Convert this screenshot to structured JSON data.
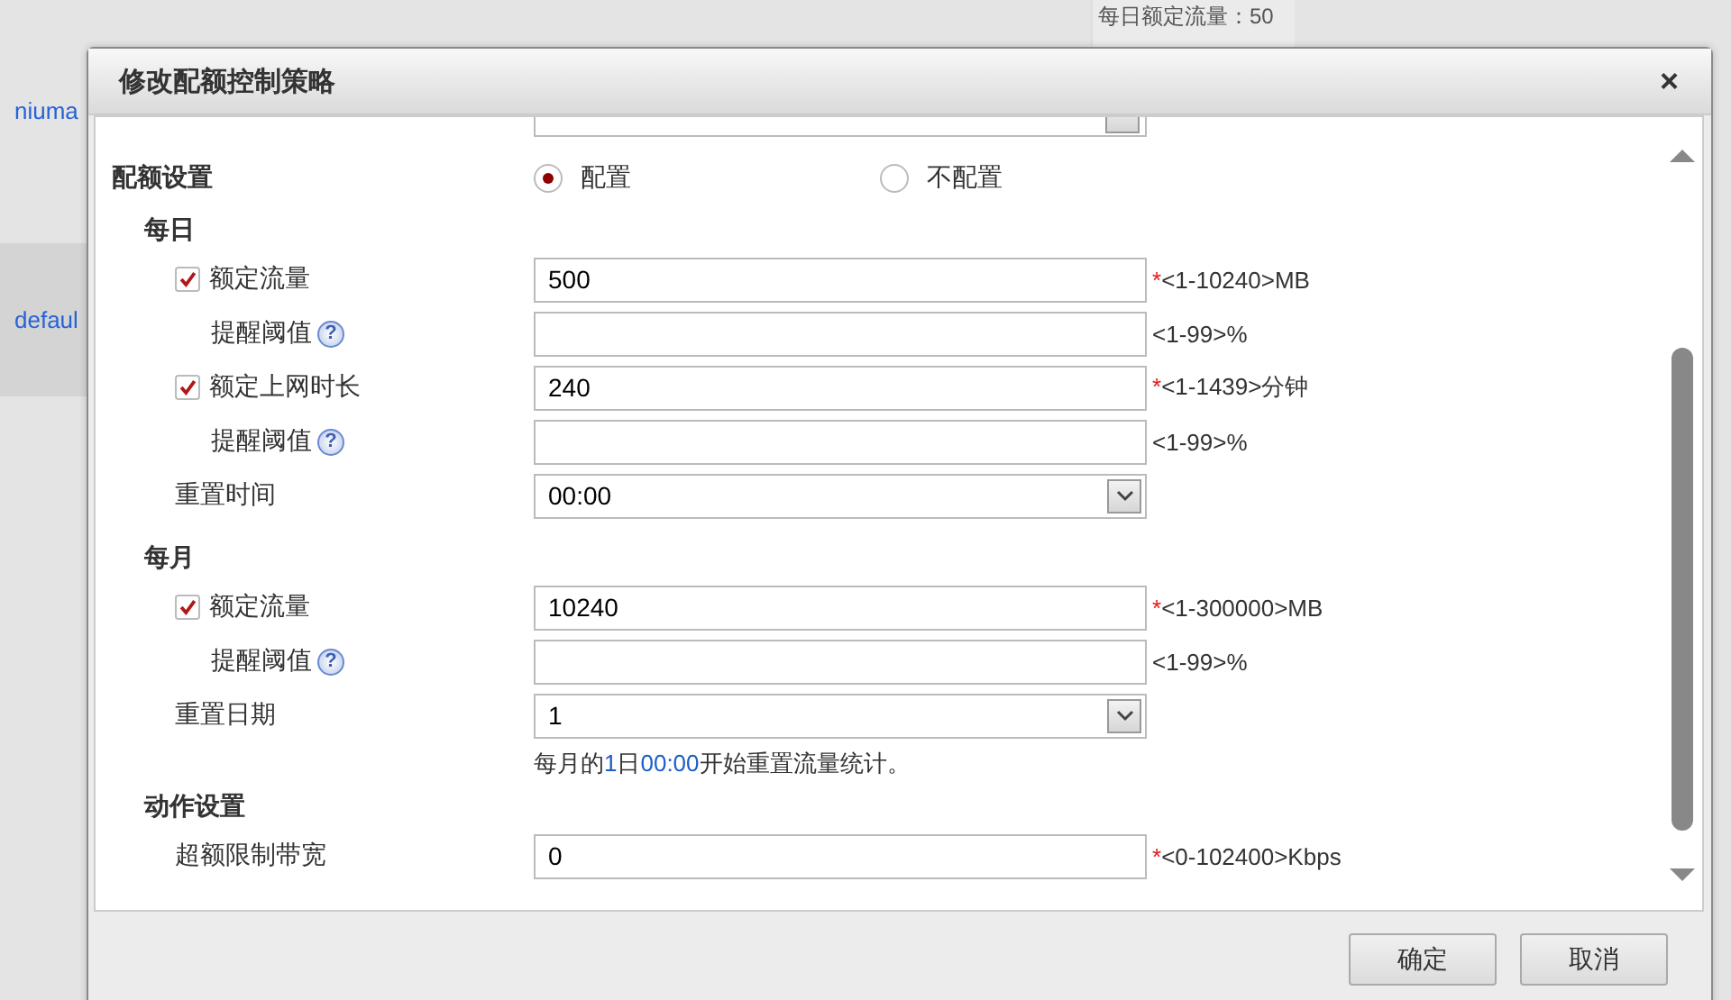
{
  "background": {
    "items": [
      {
        "label": "niuma"
      },
      {
        "label": "defaul"
      }
    ],
    "detail_text": "每日额定流量：50"
  },
  "dialog": {
    "title": "修改配额控制策略",
    "close": "×"
  },
  "quota_setting": {
    "label": "配额设置",
    "options": [
      {
        "label": "配置",
        "selected": true
      },
      {
        "label": "不配置",
        "selected": false
      }
    ]
  },
  "sections": [
    {
      "title": "每日",
      "rows": [
        {
          "kind": "check",
          "label": "额定流量",
          "checked": true,
          "value": "500",
          "mark": "*",
          "hint": "<1-10240>MB"
        },
        {
          "kind": "threshold",
          "label": "提醒阈值",
          "help": "?",
          "hint": "<1-99>%"
        },
        {
          "kind": "check",
          "label": "额定上网时长",
          "checked": true,
          "value": "240",
          "mark": "*",
          "hint": "<1-1439>分钟"
        },
        {
          "kind": "threshold",
          "label": "提醒阈值",
          "help": "?",
          "hint": "<1-99>%"
        },
        {
          "kind": "select",
          "label": "重置时间",
          "value": "00:00"
        }
      ]
    },
    {
      "title": "每月",
      "rows": [
        {
          "kind": "check",
          "label": "额定流量",
          "checked": true,
          "value": "10240",
          "mark": "*",
          "hint": "<1-300000>MB"
        },
        {
          "kind": "threshold",
          "label": "提醒阈值",
          "help": "?",
          "hint": "<1-99>%"
        },
        {
          "kind": "select",
          "label": "重置日期",
          "value": "1"
        },
        {
          "kind": "note",
          "parts": [
            {
              "text": "每月的",
              "emphasis": false
            },
            {
              "text": "1",
              "emphasis": true
            },
            {
              "text": "日",
              "emphasis": false
            },
            {
              "text": "00:00",
              "emphasis": true
            },
            {
              "text": "开始重置流量统计。",
              "emphasis": false
            }
          ]
        }
      ]
    },
    {
      "title": "动作设置",
      "rows": [
        {
          "kind": "input",
          "label": "超额限制带宽",
          "value": "0",
          "mark": "*",
          "hint": "<0-102400>Kbps"
        }
      ]
    }
  ],
  "buttons": [
    {
      "label": "确定"
    },
    {
      "label": "取消"
    }
  ]
}
